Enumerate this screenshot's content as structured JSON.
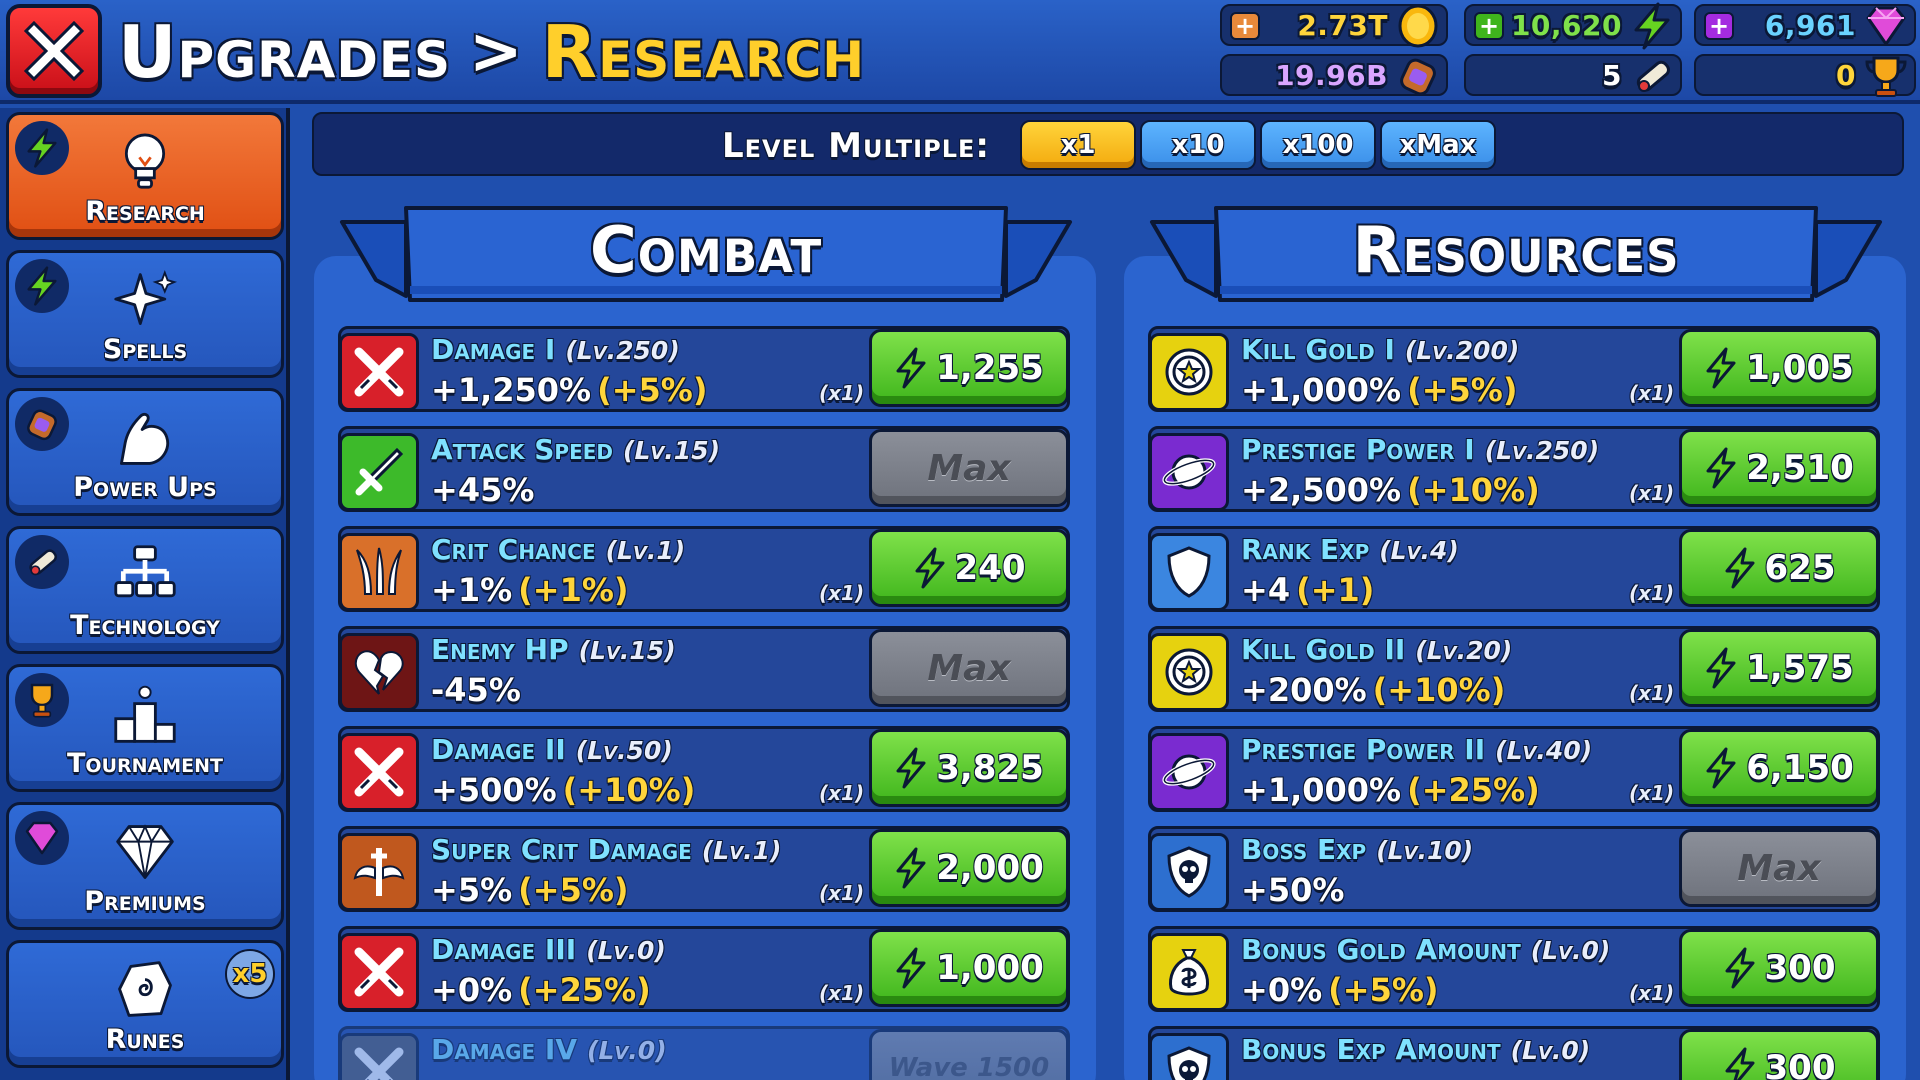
{
  "header": {
    "crumb": "Upgrades",
    "separator": ">",
    "current": "Research"
  },
  "resources": {
    "gold": "2.73T",
    "energy": "10,620",
    "gems": "6,961",
    "elixir": "19.96B",
    "scrolls": "5",
    "trophies": "0"
  },
  "sidebar": {
    "items": [
      {
        "label": "Research",
        "active": true
      },
      {
        "label": "Spells"
      },
      {
        "label": "Power Ups"
      },
      {
        "label": "Technology"
      },
      {
        "label": "Tournament"
      },
      {
        "label": "Premiums"
      },
      {
        "label": "Runes",
        "badge": "x5"
      }
    ]
  },
  "level_multiple": {
    "label": "Level Multiple:",
    "options": [
      "x1",
      "x10",
      "x100",
      "xMax"
    ],
    "selected": "x1"
  },
  "combat": {
    "title": "Combat",
    "rows": [
      {
        "name": "Damage I",
        "level": "(Lv.250)",
        "value": "+1,250%",
        "bonus": "(+5%)",
        "mult": "(x1)",
        "cost": "1,255",
        "icon": "crossed-swords-icon",
        "color": "#d8202a"
      },
      {
        "name": "Attack Speed",
        "level": "(Lv.15)",
        "value": "+45%",
        "bonus": "",
        "mult": "",
        "cost": "Max",
        "icon": "sword-icon",
        "color": "#3dba2a"
      },
      {
        "name": "Crit Chance",
        "level": "(Lv.1)",
        "value": "+1%",
        "bonus": "(+1%)",
        "mult": "(x1)",
        "cost": "240",
        "icon": "claws-icon",
        "color": "#d9702a"
      },
      {
        "name": "Enemy HP",
        "level": "(Lv.15)",
        "value": "-45%",
        "bonus": "",
        "mult": "",
        "cost": "Max",
        "icon": "broken-heart-icon",
        "color": "#6e1515"
      },
      {
        "name": "Damage II",
        "level": "(Lv.50)",
        "value": "+500%",
        "bonus": "(+10%)",
        "mult": "(x1)",
        "cost": "3,825",
        "icon": "crossed-swords-icon",
        "color": "#d8202a"
      },
      {
        "name": "Super Crit Damage",
        "level": "(Lv.1)",
        "value": "+5%",
        "bonus": "(+5%)",
        "mult": "(x1)",
        "cost": "2,000",
        "icon": "winged-sword-icon",
        "color": "#c0581e"
      },
      {
        "name": "Damage III",
        "level": "(Lv.0)",
        "value": "+0%",
        "bonus": "(+25%)",
        "mult": "(x1)",
        "cost": "1,000",
        "icon": "crossed-swords-icon",
        "color": "#d8202a"
      },
      {
        "name": "Damage IV",
        "level": "(Lv.0)",
        "value": "",
        "bonus": "",
        "mult": "",
        "cost": "Wave 1500",
        "icon": "crossed-swords-icon",
        "color": "#555a63"
      }
    ]
  },
  "resources_panel": {
    "title": "Resources",
    "rows": [
      {
        "name": "Kill Gold I",
        "level": "(Lv.200)",
        "value": "+1,000%",
        "bonus": "(+5%)",
        "mult": "(x1)",
        "cost": "1,005",
        "icon": "coin-star-icon",
        "color": "#e6d20f"
      },
      {
        "name": "Prestige Power I",
        "level": "(Lv.250)",
        "value": "+2,500%",
        "bonus": "(+10%)",
        "mult": "(x1)",
        "cost": "2,510",
        "icon": "planet-icon",
        "color": "#7a2bd0"
      },
      {
        "name": "Rank Exp",
        "level": "(Lv.4)",
        "value": "+4",
        "bonus": "(+1)",
        "mult": "(x1)",
        "cost": "625",
        "icon": "shield-icon",
        "color": "#3b86e0"
      },
      {
        "name": "Kill Gold II",
        "level": "(Lv.20)",
        "value": "+200%",
        "bonus": "(+10%)",
        "mult": "(x1)",
        "cost": "1,575",
        "icon": "coin-star-icon",
        "color": "#e6d20f"
      },
      {
        "name": "Prestige Power II",
        "level": "(Lv.40)",
        "value": "+1,000%",
        "bonus": "(+25%)",
        "mult": "(x1)",
        "cost": "6,150",
        "icon": "planet-icon",
        "color": "#7a2bd0"
      },
      {
        "name": "Boss Exp",
        "level": "(Lv.10)",
        "value": "+50%",
        "bonus": "",
        "mult": "",
        "cost": "Max",
        "icon": "skull-badge-icon",
        "color": "#2d6fcf"
      },
      {
        "name": "Bonus Gold Amount",
        "level": "(Lv.0)",
        "value": "+0%",
        "bonus": "(+5%)",
        "mult": "(x1)",
        "cost": "300",
        "icon": "money-bag-icon",
        "color": "#e6d20f"
      },
      {
        "name": "Bonus Exp Amount",
        "level": "(Lv.0)",
        "value": "",
        "bonus": "",
        "mult": "",
        "cost": "300",
        "icon": "skull-badge-icon",
        "color": "#2d6fcf"
      }
    ]
  }
}
